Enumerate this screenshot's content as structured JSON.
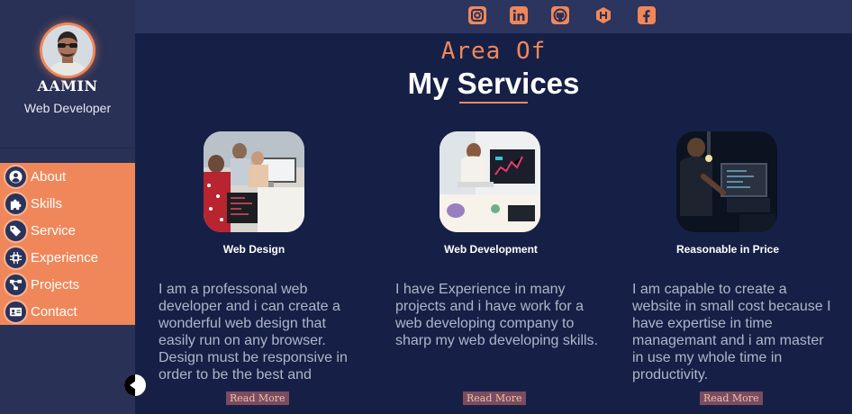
{
  "profile": {
    "name": "AAMIN",
    "role": "Web Developer"
  },
  "social": [
    {
      "icon": "instagram-icon"
    },
    {
      "icon": "linkedin-icon"
    },
    {
      "icon": "github-icon"
    },
    {
      "icon": "hackerrank-icon"
    },
    {
      "icon": "facebook-icon"
    }
  ],
  "menu": [
    {
      "label": "About",
      "icon": "user-circle-icon"
    },
    {
      "label": "Skills",
      "icon": "puzzle-icon"
    },
    {
      "label": "Service",
      "icon": "tags-icon"
    },
    {
      "label": "Experience",
      "icon": "chip-icon"
    },
    {
      "label": "Projects",
      "icon": "project-diagram-icon"
    },
    {
      "label": "Contact",
      "icon": "address-card-icon"
    }
  ],
  "section": {
    "subtitle": "Area Of",
    "title": "My Services"
  },
  "services": [
    {
      "title": "Web Design",
      "text": "I am a professonal web developer and i can create a wonderful web design that easily run on any browser. Design must be responsive in order to be the best and",
      "button": "Read More"
    },
    {
      "title": "Web Development",
      "text": "I have Experience in many projects and i have work for a web developing company to sharp my web developing skills.",
      "button": "Read More"
    },
    {
      "title": "Reasonable in Price",
      "text": "I am capable to create a website in small cost because I have expertise in time managemant and i am master in use my whole time in productivity.",
      "button": "Read More"
    }
  ],
  "colors": {
    "accent": "#f0875a",
    "sidebar": "#293157",
    "main": "#162046"
  }
}
